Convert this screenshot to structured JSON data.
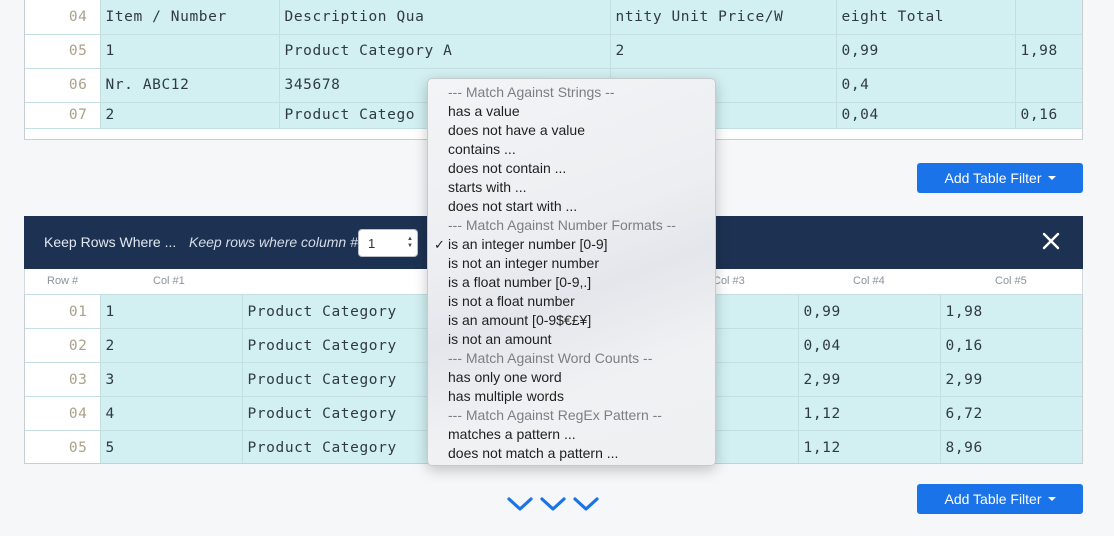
{
  "top_table": {
    "rows": [
      {
        "num": "04",
        "cells": [
          "Item  /  Number",
          "Description Qua",
          "ntity Unit  Price/W",
          "eight Total",
          ""
        ]
      },
      {
        "num": "05",
        "cells": [
          "1",
          "Product  Category  A",
          "2",
          "0,99",
          "1,98"
        ]
      },
      {
        "num": "06",
        "cells": [
          "Nr.  ABC12",
          "345678",
          "",
          "0,4",
          ""
        ]
      },
      {
        "num": "07",
        "cells": [
          "2",
          "Product  Catego",
          "",
          "0,04",
          "0,16"
        ]
      }
    ]
  },
  "add_filter": {
    "label": "Add Table Filter"
  },
  "filter_bar": {
    "title": "Keep Rows Where ...",
    "hint": "Keep rows where column #",
    "column_value": "1"
  },
  "col_header": [
    "Row #",
    "Col #1",
    "Col #3",
    "Col #4",
    "Col #5"
  ],
  "bottom_table": {
    "rows": [
      {
        "num": "01",
        "cells": [
          "1",
          "Product  Category",
          "",
          "0,99",
          "1,98"
        ]
      },
      {
        "num": "02",
        "cells": [
          "2",
          "Product  Category",
          "",
          "0,04",
          "0,16"
        ]
      },
      {
        "num": "03",
        "cells": [
          "3",
          "Product  Category",
          "",
          "2,99",
          "2,99"
        ]
      },
      {
        "num": "04",
        "cells": [
          "4",
          "Product  Category",
          "",
          "1,12",
          "6,72"
        ]
      },
      {
        "num": "05",
        "cells": [
          "5",
          "Product  Category",
          "",
          "1,12",
          "8,96"
        ]
      }
    ]
  },
  "dropdown": {
    "items": [
      {
        "label": "--- Match Against Strings --",
        "header": true
      },
      {
        "label": "has a value"
      },
      {
        "label": "does not have a value"
      },
      {
        "label": "contains ..."
      },
      {
        "label": "does not contain ..."
      },
      {
        "label": "starts with ..."
      },
      {
        "label": "does not start with ..."
      },
      {
        "label": "--- Match Against Number Formats --",
        "header": true
      },
      {
        "label": "is an integer number [0-9]",
        "checked": true
      },
      {
        "label": "is not an integer number"
      },
      {
        "label": "is a float number [0-9,.]"
      },
      {
        "label": "is not a float number"
      },
      {
        "label": "is an amount [0-9$€£¥]"
      },
      {
        "label": "is not an amount"
      },
      {
        "label": "--- Match Against Word Counts --",
        "header": true
      },
      {
        "label": "has only one word"
      },
      {
        "label": "has multiple words"
      },
      {
        "label": "--- Match Against RegEx Pattern --",
        "header": true
      },
      {
        "label": "matches a pattern ..."
      },
      {
        "label": "does not match a pattern ..."
      }
    ]
  },
  "colors": {
    "accent": "#1a73e8",
    "bar": "#1d3252",
    "cell": "#d2eff1"
  }
}
